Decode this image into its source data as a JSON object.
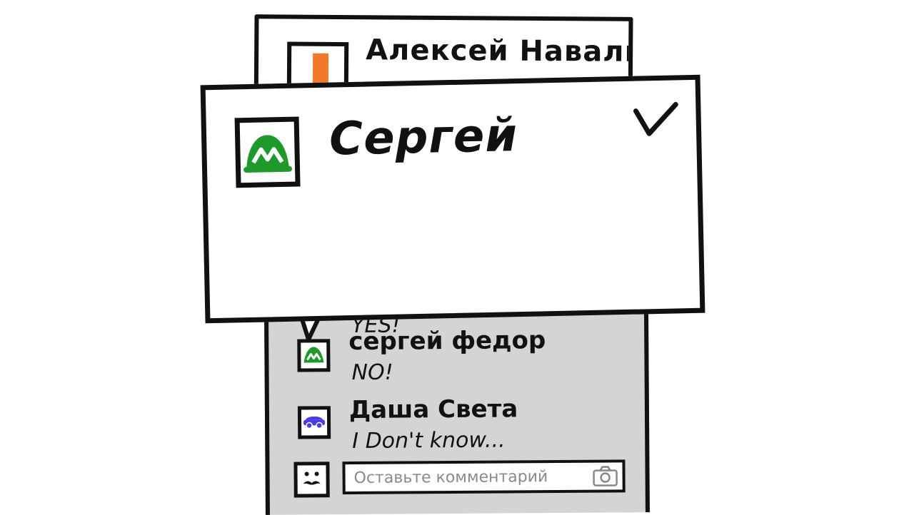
{
  "post": {
    "author": "Алексей Навальный"
  },
  "comments": {
    "partial_text": "YES!",
    "items": [
      {
        "author": "сергей федор",
        "text": "NO!"
      },
      {
        "author": "Даша Света",
        "text": "I Don't know..."
      }
    ],
    "input": {
      "placeholder": "Оставьте комментарий"
    }
  },
  "popup": {
    "name": "Сергей"
  },
  "icons": {
    "popup_avatar": "green-mountain-avatar-icon",
    "dasha_avatar": "blue-car-avatar-icon",
    "me_avatar": "mustache-face-icon",
    "confirm": "check-icon",
    "camera": "camera-icon"
  },
  "colors": {
    "panel_bg": "#d4d4d4",
    "accent_green": "#1f9a2a",
    "accent_blue": "#4a3ce0",
    "accent_orange": "#f07a2a",
    "stroke": "#111111"
  }
}
